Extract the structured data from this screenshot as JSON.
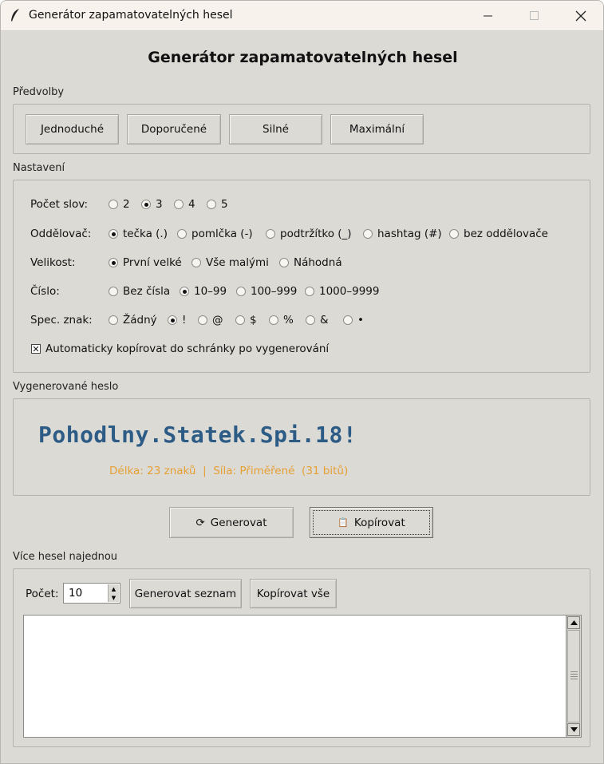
{
  "window": {
    "title": "Generátor zapamatovatelných hesel"
  },
  "heading": "Generátor zapamatovatelných hesel",
  "presets": {
    "label": "Předvolby",
    "buttons": [
      "Jednoduché",
      "Doporučené",
      "Silné",
      "Maximální"
    ]
  },
  "settings": {
    "label": "Nastavení",
    "word_count": {
      "label": "Počet slov:",
      "options": [
        "2",
        "3",
        "4",
        "5"
      ],
      "selected": "3"
    },
    "separator": {
      "label": "Oddělovač:",
      "options": [
        "tečka (.)",
        "pomlčka (-)",
        "podtržítko (_)",
        "hashtag (#)",
        "bez oddělovače"
      ],
      "selected": "tečka (.)"
    },
    "case": {
      "label": "Velikost:",
      "options": [
        "První velké",
        "Vše malými",
        "Náhodná"
      ],
      "selected": "První velké"
    },
    "number": {
      "label": "Číslo:",
      "options": [
        "Bez čísla",
        "10–99",
        "100–999",
        "1000–9999"
      ],
      "selected": "10–99"
    },
    "special": {
      "label": "Spec. znak:",
      "options": [
        "Žádný",
        "!",
        "@",
        "$",
        "%",
        "&",
        "•"
      ],
      "selected": "!"
    },
    "auto_copy": {
      "label": "Automaticky kopírovat do schránky po vygenerování",
      "checked": true
    }
  },
  "result": {
    "label": "Vygenerované heslo",
    "password": "Pohodlny.Statek.Spi.18!",
    "info": "Délka: 23 znaků  |  Síla: Přiměřené  (31 bitů)"
  },
  "actions": {
    "generate": "Generovat",
    "generate_icon": "⟳",
    "copy": "Kopírovat",
    "copy_icon": "📋"
  },
  "bulk": {
    "label": "Více hesel najednou",
    "count_label": "Počet:",
    "count_value": "10",
    "generate_list": "Generovat seznam",
    "copy_all": "Kopírovat vše",
    "output": ""
  },
  "colors": {
    "password": "#2c5b85",
    "info": "#e6a034",
    "window_bg": "#dcdad5"
  }
}
